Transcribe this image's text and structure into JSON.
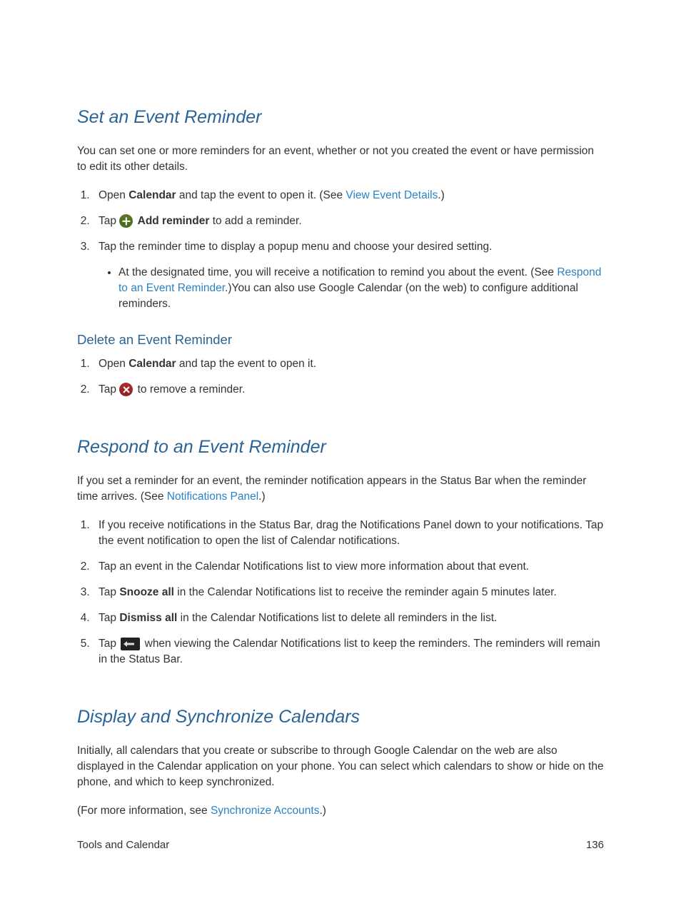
{
  "sections": {
    "set_reminder": {
      "heading": "Set an Event Reminder",
      "intro": "You can set one or more reminders for an event, whether or not you created the event or have permission to edit its other details.",
      "steps": {
        "s1_pre": "Open ",
        "s1_bold": "Calendar",
        "s1_mid": " and tap the event to open it. (See ",
        "s1_link": "View Event Details",
        "s1_post": ".)",
        "s2_pre": "Tap ",
        "s2_bold": "Add reminder",
        "s2_post": " to add a reminder.",
        "s3": "Tap the reminder time to display a popup menu and choose your desired setting.",
        "s3_sub_pre": "At the designated time, you will receive a notification to remind you about the event. (See ",
        "s3_sub_link": "Respond to an Event Reminder",
        "s3_sub_post": ".)You can also use Google Calendar (on the web) to configure additional reminders."
      },
      "delete": {
        "heading": "Delete an Event Reminder",
        "s1_pre": "Open ",
        "s1_bold": "Calendar",
        "s1_post": " and tap the event to open it.",
        "s2_pre": "Tap ",
        "s2_post": " to remove a reminder."
      }
    },
    "respond": {
      "heading": "Respond to an Event Reminder",
      "intro_pre": "If you set a reminder for an event, the reminder notification appears in the Status Bar when the reminder time arrives. (See ",
      "intro_link": "Notifications Panel",
      "intro_post": ".)",
      "steps": {
        "s1": "If you receive notifications in the Status Bar, drag the Notifications Panel down to your notifications. Tap the event notification to open the list of Calendar notifications.",
        "s2": "Tap an event in the Calendar Notifications list to view more information about that event.",
        "s3_pre": "Tap ",
        "s3_bold": "Snooze all",
        "s3_post": " in the Calendar Notifications list to receive the reminder again 5 minutes later.",
        "s4_pre": "Tap ",
        "s4_bold": "Dismiss all",
        "s4_post": " in the Calendar Notifications list to delete all reminders in the list.",
        "s5_pre": "Tap ",
        "s5_post": " when viewing the Calendar Notifications list to keep the reminders. The reminders will remain in the Status Bar."
      }
    },
    "display_sync": {
      "heading": "Display and Synchronize Calendars",
      "intro": "Initially, all calendars that you create or subscribe to through Google Calendar on the web are also displayed in the Calendar application on your phone. You can select which calendars to show or hide on the phone, and which to keep synchronized.",
      "more_pre": "(For more information, see ",
      "more_link": "Synchronize Accounts",
      "more_post": ".)"
    }
  },
  "footer": {
    "left": "Tools and Calendar",
    "right": "136"
  }
}
